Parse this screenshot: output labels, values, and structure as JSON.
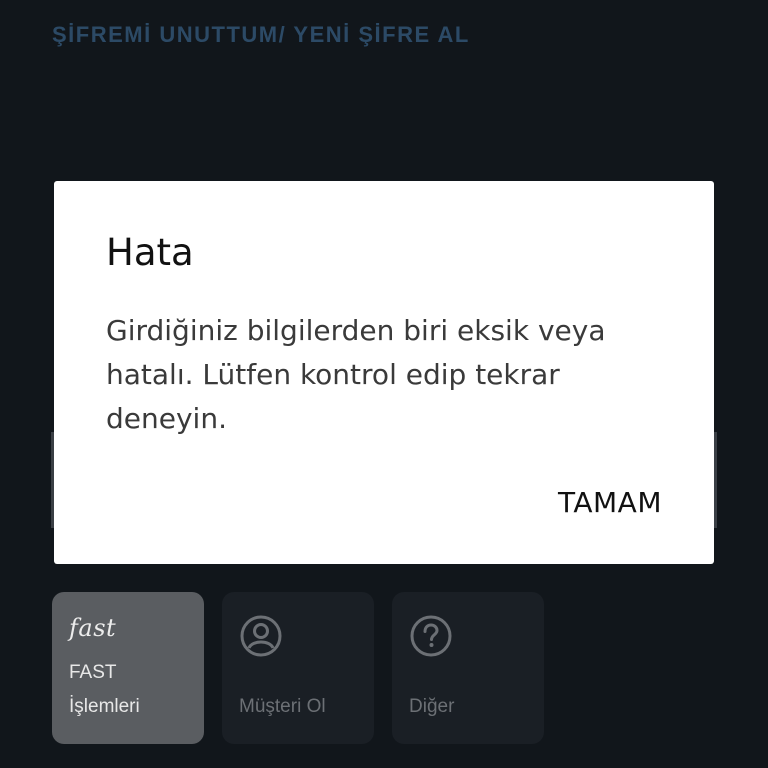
{
  "header": {
    "forgot_password_link": "ŞİFREMİ UNUTTUM/ YENİ ŞİFRE AL"
  },
  "tiles": [
    {
      "logo_text": "fast",
      "label": "FAST İşlemleri",
      "icon": "fast-logo",
      "active": true
    },
    {
      "label": "Müşteri Ol",
      "icon": "user-circle-icon",
      "active": false
    },
    {
      "label": "Diğer",
      "icon": "question-circle-icon",
      "active": false
    }
  ],
  "dialog": {
    "title": "Hata",
    "message": "Girdiğiniz bilgilerden biri eksik veya hatalı. Lütfen kontrol edip tekrar deneyin.",
    "ok_button": "TAMAM"
  },
  "colors": {
    "background": "#11161b",
    "link": "#2c4a66",
    "tile": "#1a1f25",
    "tile_active": "#5a5d61",
    "dialog": "#ffffff"
  }
}
